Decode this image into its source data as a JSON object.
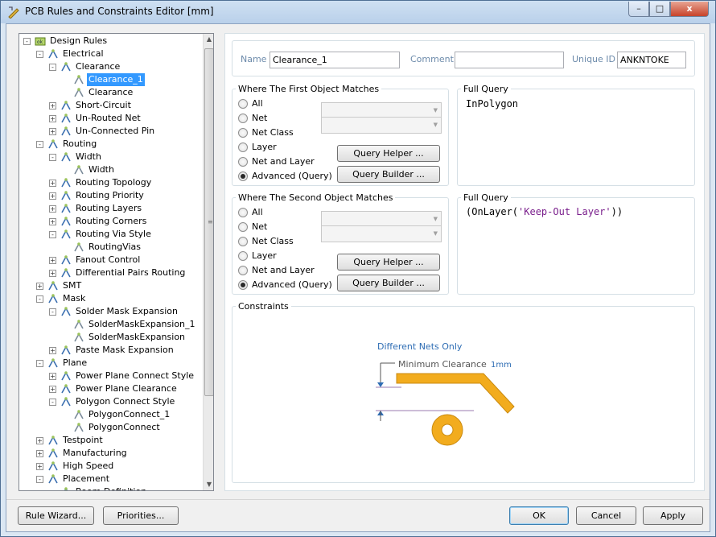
{
  "window": {
    "title": "PCB Rules and Constraints Editor [mm]",
    "min": "–",
    "max": "□",
    "close": "x"
  },
  "tree": {
    "items": [
      {
        "label": "Design Rules",
        "depth": 0,
        "exp": "−",
        "icon": "design-rules-icon"
      },
      {
        "label": "Electrical",
        "depth": 1,
        "exp": "−",
        "icon": "electrical-icon"
      },
      {
        "label": "Clearance",
        "depth": 2,
        "exp": "−",
        "icon": "clearance-icon"
      },
      {
        "label": "Clearance_1",
        "depth": 3,
        "exp": "",
        "icon": "clearance-rule-icon",
        "selected": true
      },
      {
        "label": "Clearance",
        "depth": 3,
        "exp": "",
        "icon": "clearance-rule-icon"
      },
      {
        "label": "Short-Circuit",
        "depth": 2,
        "exp": "+",
        "icon": "short-circuit-icon"
      },
      {
        "label": "Un-Routed Net",
        "depth": 2,
        "exp": "+",
        "icon": "unrouted-net-icon"
      },
      {
        "label": "Un-Connected Pin",
        "depth": 2,
        "exp": "+",
        "icon": "unconnected-pin-icon"
      },
      {
        "label": "Routing",
        "depth": 1,
        "exp": "−",
        "icon": "routing-icon"
      },
      {
        "label": "Width",
        "depth": 2,
        "exp": "−",
        "icon": "width-icon"
      },
      {
        "label": "Width",
        "depth": 3,
        "exp": "",
        "icon": "width-rule-icon"
      },
      {
        "label": "Routing Topology",
        "depth": 2,
        "exp": "+",
        "icon": "routing-topology-icon"
      },
      {
        "label": "Routing Priority",
        "depth": 2,
        "exp": "+",
        "icon": "routing-priority-icon"
      },
      {
        "label": "Routing Layers",
        "depth": 2,
        "exp": "+",
        "icon": "routing-layers-icon"
      },
      {
        "label": "Routing Corners",
        "depth": 2,
        "exp": "+",
        "icon": "routing-corners-icon"
      },
      {
        "label": "Routing Via Style",
        "depth": 2,
        "exp": "−",
        "icon": "via-style-icon"
      },
      {
        "label": "RoutingVias",
        "depth": 3,
        "exp": "",
        "icon": "via-rule-icon"
      },
      {
        "label": "Fanout Control",
        "depth": 2,
        "exp": "+",
        "icon": "fanout-icon"
      },
      {
        "label": "Differential Pairs Routing",
        "depth": 2,
        "exp": "+",
        "icon": "diff-pairs-icon"
      },
      {
        "label": "SMT",
        "depth": 1,
        "exp": "+",
        "icon": "smt-icon"
      },
      {
        "label": "Mask",
        "depth": 1,
        "exp": "−",
        "icon": "mask-icon"
      },
      {
        "label": "Solder Mask Expansion",
        "depth": 2,
        "exp": "−",
        "icon": "solder-mask-icon"
      },
      {
        "label": "SolderMaskExpansion_1",
        "depth": 3,
        "exp": "",
        "icon": "solder-mask-rule-icon"
      },
      {
        "label": "SolderMaskExpansion",
        "depth": 3,
        "exp": "",
        "icon": "solder-mask-rule-icon"
      },
      {
        "label": "Paste Mask Expansion",
        "depth": 2,
        "exp": "+",
        "icon": "paste-mask-icon"
      },
      {
        "label": "Plane",
        "depth": 1,
        "exp": "−",
        "icon": "plane-icon"
      },
      {
        "label": "Power Plane Connect Style",
        "depth": 2,
        "exp": "+",
        "icon": "plane-connect-icon"
      },
      {
        "label": "Power Plane Clearance",
        "depth": 2,
        "exp": "+",
        "icon": "plane-clearance-icon"
      },
      {
        "label": "Polygon Connect Style",
        "depth": 2,
        "exp": "−",
        "icon": "polygon-connect-icon"
      },
      {
        "label": "PolygonConnect_1",
        "depth": 3,
        "exp": "",
        "icon": "polygon-rule-icon"
      },
      {
        "label": "PolygonConnect",
        "depth": 3,
        "exp": "",
        "icon": "polygon-rule-icon"
      },
      {
        "label": "Testpoint",
        "depth": 1,
        "exp": "+",
        "icon": "testpoint-icon"
      },
      {
        "label": "Manufacturing",
        "depth": 1,
        "exp": "+",
        "icon": "manufacturing-icon"
      },
      {
        "label": "High Speed",
        "depth": 1,
        "exp": "+",
        "icon": "high-speed-icon"
      },
      {
        "label": "Placement",
        "depth": 1,
        "exp": "−",
        "icon": "placement-icon"
      },
      {
        "label": "Room Definition",
        "depth": 2,
        "exp": "",
        "icon": "room-icon"
      }
    ]
  },
  "header": {
    "name_label": "Name",
    "name_value": "Clearance_1",
    "comment_label": "Comment",
    "comment_value": "",
    "uid_label": "Unique ID",
    "uid_value": "ANKNTOKE"
  },
  "first": {
    "title": "Where The First Object Matches",
    "options": [
      "All",
      "Net",
      "Net Class",
      "Layer",
      "Net and Layer",
      "Advanced (Query)"
    ],
    "selected": 5,
    "helper": "Query Helper ...",
    "builder": "Query Builder ...",
    "fq_title": "Full Query",
    "query": "InPolygon"
  },
  "second": {
    "title": "Where The Second Object Matches",
    "options": [
      "All",
      "Net",
      "Net Class",
      "Layer",
      "Net and Layer",
      "Advanced (Query)"
    ],
    "selected": 5,
    "helper": "Query Helper ...",
    "builder": "Query Builder ...",
    "fq_title": "Full Query",
    "query_pre": "(OnLayer(",
    "query_str": "'Keep-Out Layer'",
    "query_post": "))"
  },
  "constraints": {
    "title": "Constraints",
    "diff_nets": "Different Nets Only",
    "min_clearance": "Minimum Clearance",
    "value": "1mm",
    "accent": "#2e6db4",
    "trace_color": "#f2ac1e"
  },
  "footer": {
    "rule_wizard": "Rule Wizard...",
    "priorities": "Priorities...",
    "ok": "OK",
    "cancel": "Cancel",
    "apply": "Apply"
  }
}
